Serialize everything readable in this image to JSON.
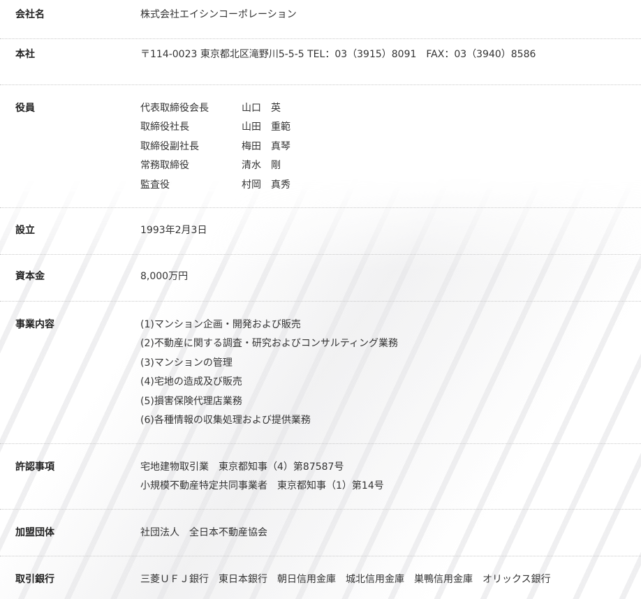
{
  "company": {
    "rows": [
      {
        "label": "会社名",
        "value": "株式会社エイシンコーポレーション"
      },
      {
        "label": "本社",
        "value": "〒114-0023 東京都北区滝野川5-5-5 TEL：03（3915）8091　FAX：03（3940）8586"
      },
      {
        "label": "役員"
      },
      {
        "label": "設立",
        "value": "1993年2月3日"
      },
      {
        "label": "資本金",
        "value": "8,000万円"
      },
      {
        "label": "事業内容"
      },
      {
        "label": "許認事項"
      },
      {
        "label": "加盟団体",
        "value": "社団法人　全日本不動産協会"
      },
      {
        "label": "取引銀行",
        "value": "三菱ＵＦＪ銀行　東日本銀行　朝日信用金庫　城北信用金庫　巣鴨信用金庫　オリックス銀行"
      }
    ],
    "officers": [
      {
        "title": "代表取締役会長",
        "name": "山口　英"
      },
      {
        "title": "取締役社長",
        "name": "山田　重範"
      },
      {
        "title": "取締役副社長",
        "name": "梅田　真琴"
      },
      {
        "title": "常務取締役",
        "name": "清水　剛"
      },
      {
        "title": "監査役",
        "name": "村岡　真秀"
      }
    ],
    "business": [
      "(1)マンション企画・開発および販売",
      "(2)不動産に関する調査・研究およびコンサルティング業務",
      "(3)マンションの管理",
      "(4)宅地の造成及び販売",
      "(5)損害保険代理店業務",
      "(6)各種情報の収集処理および提供業務"
    ],
    "licenses": [
      "宅地建物取引業　東京都知事（4）第87587号",
      "小規模不動産特定共同事業者　東京都知事（1）第14号"
    ]
  }
}
